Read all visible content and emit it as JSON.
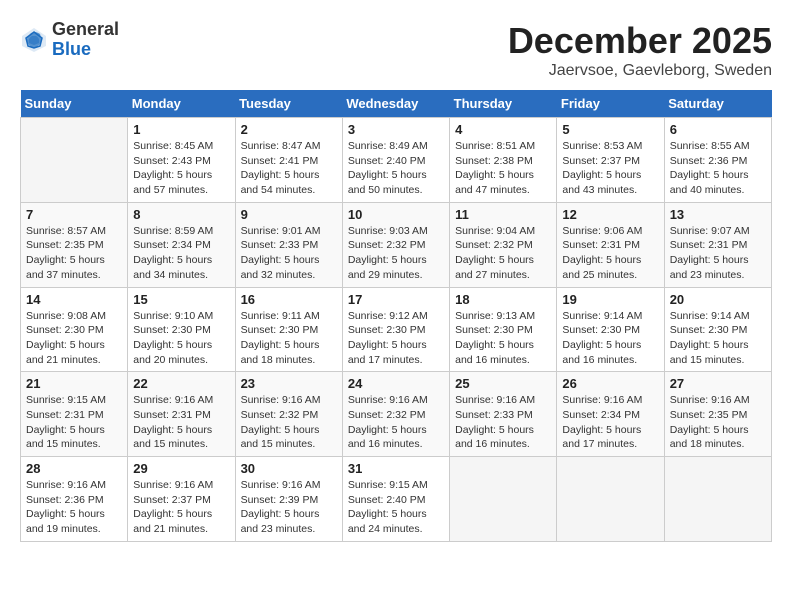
{
  "header": {
    "logo": {
      "general": "General",
      "blue": "Blue"
    },
    "title": "December 2025",
    "location": "Jaervsoe, Gaevleborg, Sweden"
  },
  "days_of_week": [
    "Sunday",
    "Monday",
    "Tuesday",
    "Wednesday",
    "Thursday",
    "Friday",
    "Saturday"
  ],
  "weeks": [
    [
      {
        "day": "",
        "info": ""
      },
      {
        "day": "1",
        "info": "Sunrise: 8:45 AM\nSunset: 2:43 PM\nDaylight: 5 hours\nand 57 minutes."
      },
      {
        "day": "2",
        "info": "Sunrise: 8:47 AM\nSunset: 2:41 PM\nDaylight: 5 hours\nand 54 minutes."
      },
      {
        "day": "3",
        "info": "Sunrise: 8:49 AM\nSunset: 2:40 PM\nDaylight: 5 hours\nand 50 minutes."
      },
      {
        "day": "4",
        "info": "Sunrise: 8:51 AM\nSunset: 2:38 PM\nDaylight: 5 hours\nand 47 minutes."
      },
      {
        "day": "5",
        "info": "Sunrise: 8:53 AM\nSunset: 2:37 PM\nDaylight: 5 hours\nand 43 minutes."
      },
      {
        "day": "6",
        "info": "Sunrise: 8:55 AM\nSunset: 2:36 PM\nDaylight: 5 hours\nand 40 minutes."
      }
    ],
    [
      {
        "day": "7",
        "info": "Sunrise: 8:57 AM\nSunset: 2:35 PM\nDaylight: 5 hours\nand 37 minutes."
      },
      {
        "day": "8",
        "info": "Sunrise: 8:59 AM\nSunset: 2:34 PM\nDaylight: 5 hours\nand 34 minutes."
      },
      {
        "day": "9",
        "info": "Sunrise: 9:01 AM\nSunset: 2:33 PM\nDaylight: 5 hours\nand 32 minutes."
      },
      {
        "day": "10",
        "info": "Sunrise: 9:03 AM\nSunset: 2:32 PM\nDaylight: 5 hours\nand 29 minutes."
      },
      {
        "day": "11",
        "info": "Sunrise: 9:04 AM\nSunset: 2:32 PM\nDaylight: 5 hours\nand 27 minutes."
      },
      {
        "day": "12",
        "info": "Sunrise: 9:06 AM\nSunset: 2:31 PM\nDaylight: 5 hours\nand 25 minutes."
      },
      {
        "day": "13",
        "info": "Sunrise: 9:07 AM\nSunset: 2:31 PM\nDaylight: 5 hours\nand 23 minutes."
      }
    ],
    [
      {
        "day": "14",
        "info": "Sunrise: 9:08 AM\nSunset: 2:30 PM\nDaylight: 5 hours\nand 21 minutes."
      },
      {
        "day": "15",
        "info": "Sunrise: 9:10 AM\nSunset: 2:30 PM\nDaylight: 5 hours\nand 20 minutes."
      },
      {
        "day": "16",
        "info": "Sunrise: 9:11 AM\nSunset: 2:30 PM\nDaylight: 5 hours\nand 18 minutes."
      },
      {
        "day": "17",
        "info": "Sunrise: 9:12 AM\nSunset: 2:30 PM\nDaylight: 5 hours\nand 17 minutes."
      },
      {
        "day": "18",
        "info": "Sunrise: 9:13 AM\nSunset: 2:30 PM\nDaylight: 5 hours\nand 16 minutes."
      },
      {
        "day": "19",
        "info": "Sunrise: 9:14 AM\nSunset: 2:30 PM\nDaylight: 5 hours\nand 16 minutes."
      },
      {
        "day": "20",
        "info": "Sunrise: 9:14 AM\nSunset: 2:30 PM\nDaylight: 5 hours\nand 15 minutes."
      }
    ],
    [
      {
        "day": "21",
        "info": "Sunrise: 9:15 AM\nSunset: 2:31 PM\nDaylight: 5 hours\nand 15 minutes."
      },
      {
        "day": "22",
        "info": "Sunrise: 9:16 AM\nSunset: 2:31 PM\nDaylight: 5 hours\nand 15 minutes."
      },
      {
        "day": "23",
        "info": "Sunrise: 9:16 AM\nSunset: 2:32 PM\nDaylight: 5 hours\nand 15 minutes."
      },
      {
        "day": "24",
        "info": "Sunrise: 9:16 AM\nSunset: 2:32 PM\nDaylight: 5 hours\nand 16 minutes."
      },
      {
        "day": "25",
        "info": "Sunrise: 9:16 AM\nSunset: 2:33 PM\nDaylight: 5 hours\nand 16 minutes."
      },
      {
        "day": "26",
        "info": "Sunrise: 9:16 AM\nSunset: 2:34 PM\nDaylight: 5 hours\nand 17 minutes."
      },
      {
        "day": "27",
        "info": "Sunrise: 9:16 AM\nSunset: 2:35 PM\nDaylight: 5 hours\nand 18 minutes."
      }
    ],
    [
      {
        "day": "28",
        "info": "Sunrise: 9:16 AM\nSunset: 2:36 PM\nDaylight: 5 hours\nand 19 minutes."
      },
      {
        "day": "29",
        "info": "Sunrise: 9:16 AM\nSunset: 2:37 PM\nDaylight: 5 hours\nand 21 minutes."
      },
      {
        "day": "30",
        "info": "Sunrise: 9:16 AM\nSunset: 2:39 PM\nDaylight: 5 hours\nand 23 minutes."
      },
      {
        "day": "31",
        "info": "Sunrise: 9:15 AM\nSunset: 2:40 PM\nDaylight: 5 hours\nand 24 minutes."
      },
      {
        "day": "",
        "info": ""
      },
      {
        "day": "",
        "info": ""
      },
      {
        "day": "",
        "info": ""
      }
    ]
  ]
}
